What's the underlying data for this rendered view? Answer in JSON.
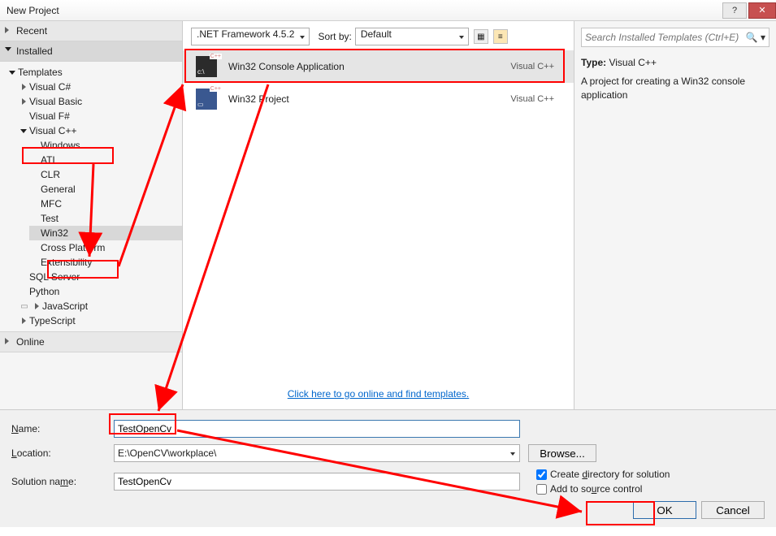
{
  "window": {
    "title": "New Project"
  },
  "left": {
    "recent": "Recent",
    "installed": "Installed",
    "online": "Online",
    "tree": {
      "templates": "Templates",
      "csharp": "Visual C#",
      "vb": "Visual Basic",
      "fsharp": "Visual F#",
      "vcpp": "Visual C++",
      "windows": "Windows",
      "atl": "ATL",
      "clr": "CLR",
      "general": "General",
      "mfc": "MFC",
      "test": "Test",
      "win32": "Win32",
      "crossplatform": "Cross Platform",
      "extensibility": "Extensibility",
      "sqlserver": "SQL Server",
      "python": "Python",
      "js": "JavaScript",
      "ts": "TypeScript"
    }
  },
  "center": {
    "framework": ".NET Framework 4.5.2",
    "sortby_label": "Sort by:",
    "sortby_value": "Default",
    "templates": [
      {
        "name": "Win32 Console Application",
        "lang": "Visual C++"
      },
      {
        "name": "Win32 Project",
        "lang": "Visual C++"
      }
    ],
    "online_link": "Click here to go online and find templates."
  },
  "right": {
    "search_placeholder": "Search Installed Templates (Ctrl+E)",
    "type_label": "Type:",
    "type_value": "Visual C++",
    "description": "A project for creating a Win32 console application"
  },
  "bottom": {
    "name_label": "Name:",
    "name_value": "TestOpenCv",
    "location_label": "Location:",
    "location_value": "E:\\OpenCV\\workplace\\",
    "browse": "Browse...",
    "solname_label": "Solution name:",
    "solname_value": "TestOpenCv",
    "create_dir": "Create directory for solution",
    "add_src": "Add to source control",
    "ok": "OK",
    "cancel": "Cancel"
  }
}
